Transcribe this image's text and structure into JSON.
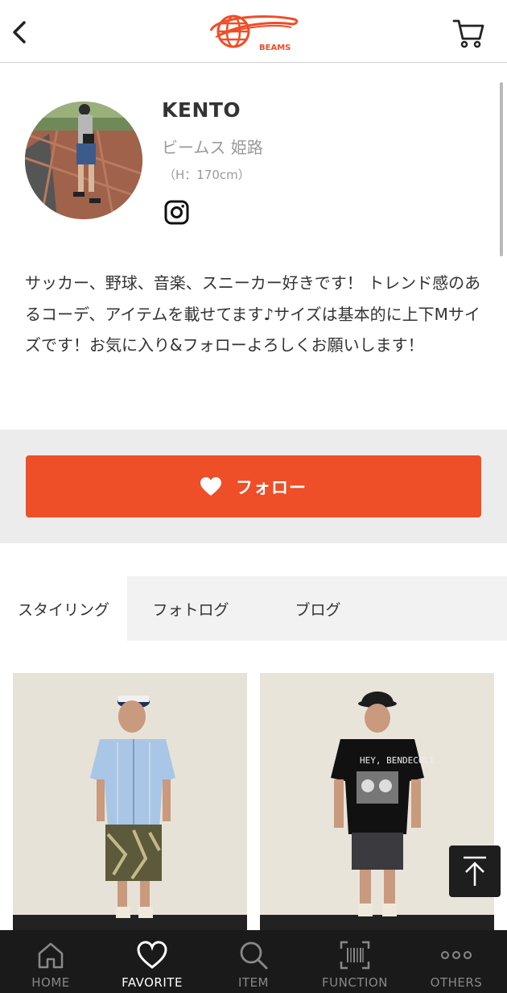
{
  "header": {
    "logo_text": "BEAMS"
  },
  "profile": {
    "name": "KENTO",
    "shop": "ビームス 姫路",
    "height": "（H：170cm）",
    "bio": "サッカー、野球、音楽、スニーカー好きです！ トレンド感のあるコーデ、アイテムを載せてます♪サイズは基本的に上下Mサイズです！お気に入り&フォローよろしくお願いします！"
  },
  "follow": {
    "label": "フォロー"
  },
  "tabs": [
    {
      "label": "スタイリング",
      "active": true
    },
    {
      "label": "フォトログ",
      "active": false
    },
    {
      "label": "ブログ",
      "active": false
    }
  ],
  "photo_text": {
    "shirt_print": "HEY, BENDECOLI"
  },
  "bottom_nav": [
    {
      "label": "HOME",
      "icon": "home-icon",
      "active": false
    },
    {
      "label": "FAVORITE",
      "icon": "heart-icon",
      "active": true
    },
    {
      "label": "ITEM",
      "icon": "search-icon",
      "active": false
    },
    {
      "label": "FUNCTION",
      "icon": "barcode-scan-icon",
      "active": false
    },
    {
      "label": "OTHERS",
      "icon": "more-dots-icon",
      "active": false
    }
  ],
  "colors": {
    "accent": "#ee4e28",
    "nav_bg": "#1a1a1a"
  }
}
